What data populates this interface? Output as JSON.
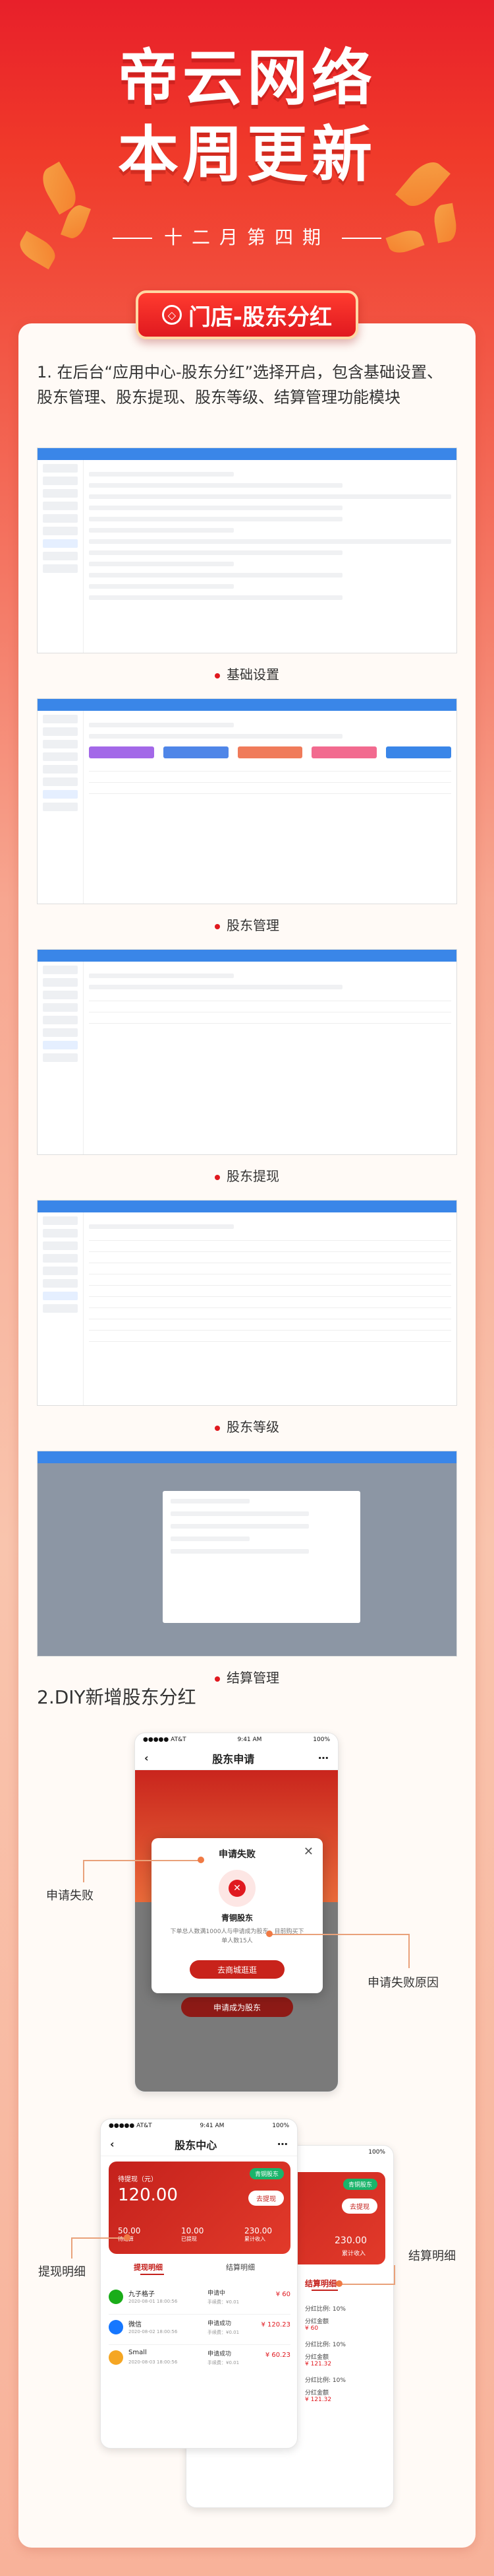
{
  "hero": {
    "title_line1": "帝云网络",
    "title_line2": "本周更新",
    "subtitle": "十二月第四期"
  },
  "tag": {
    "label": "门店-股东分红"
  },
  "step1": {
    "text": "1.  在后台“应用中心-股东分红”选择开启，包含基础设置、股东管理、股东提现、股东等级、结算管理功能模块"
  },
  "captions": {
    "basic": "基础设置",
    "manage": "股东管理",
    "withdraw": "股东提现",
    "level": "股东等级",
    "settle": "结算管理"
  },
  "step2": {
    "text": "2.DIY新增股东分红"
  },
  "apply_phone": {
    "status_carrier": "●●●●● AT&T",
    "status_time": "9:41 AM",
    "status_battery": "100%",
    "nav_title": "股东申请",
    "modal_title": "申请失败",
    "modal_heading": "青铜股东",
    "modal_desc": "下单总人数满1000人与申请成为股东，目前购买下单人数15人",
    "modal_button": "去商城逛逛",
    "bottom_button": "申请成为股东"
  },
  "labels": {
    "apply_fail": "申请失败",
    "apply_fail_reason": "申请失败原因",
    "withdraw_detail": "提现明细",
    "settle_detail": "结算明细"
  },
  "center_phone": {
    "status_carrier": "●●●●● AT&T",
    "status_time": "9:41 AM",
    "status_battery": "100%",
    "nav_title": "股东中心",
    "badge": "青铜股东",
    "wallet_label": "待提现（元）",
    "wallet_amount": "120.00",
    "withdraw_btn": "去提现",
    "stats": [
      {
        "value": "50.00",
        "label": "待结算"
      },
      {
        "value": "10.00",
        "label": "已提现"
      },
      {
        "value": "230.00",
        "label": "累计收入"
      }
    ],
    "tab_withdraw": "提现明细",
    "tab_settle": "结算明细",
    "rows": [
      {
        "name": "九子格子",
        "date": "2020-08-01 18:00:56",
        "status": "申请中",
        "fee": "手续费：¥0.01",
        "amount": "¥ 60"
      },
      {
        "name": "微信",
        "date": "2020-08-02 18:00:56",
        "status": "申请成功",
        "fee": "手续费：¥0.01",
        "amount": "¥ 120.23"
      },
      {
        "name": "Small",
        "date": "2020-08-03 18:00:56",
        "status": "申请成功",
        "fee": "手续费：¥0.01",
        "amount": "¥ 60.23"
      }
    ]
  },
  "back_phone": {
    "status_battery": "100%",
    "badge": "青铜股东",
    "withdraw_btn": "去提现",
    "stat_value": "230.00",
    "stat_label": "累计收入",
    "tab_settle": "结算明细",
    "rows": [
      {
        "ratio": "分红比例: 10%",
        "label": "分红金额",
        "amount": "¥ 60"
      },
      {
        "ratio": "分红比例: 10%",
        "label": "分红金额",
        "amount": "¥ 121.32"
      },
      {
        "ratio": "分红比例: 10%",
        "label": "分红金额",
        "amount": "¥ 121.32"
      }
    ]
  },
  "colors": {
    "accent": "#e0191f",
    "admin_blue": "#3a86e8"
  }
}
